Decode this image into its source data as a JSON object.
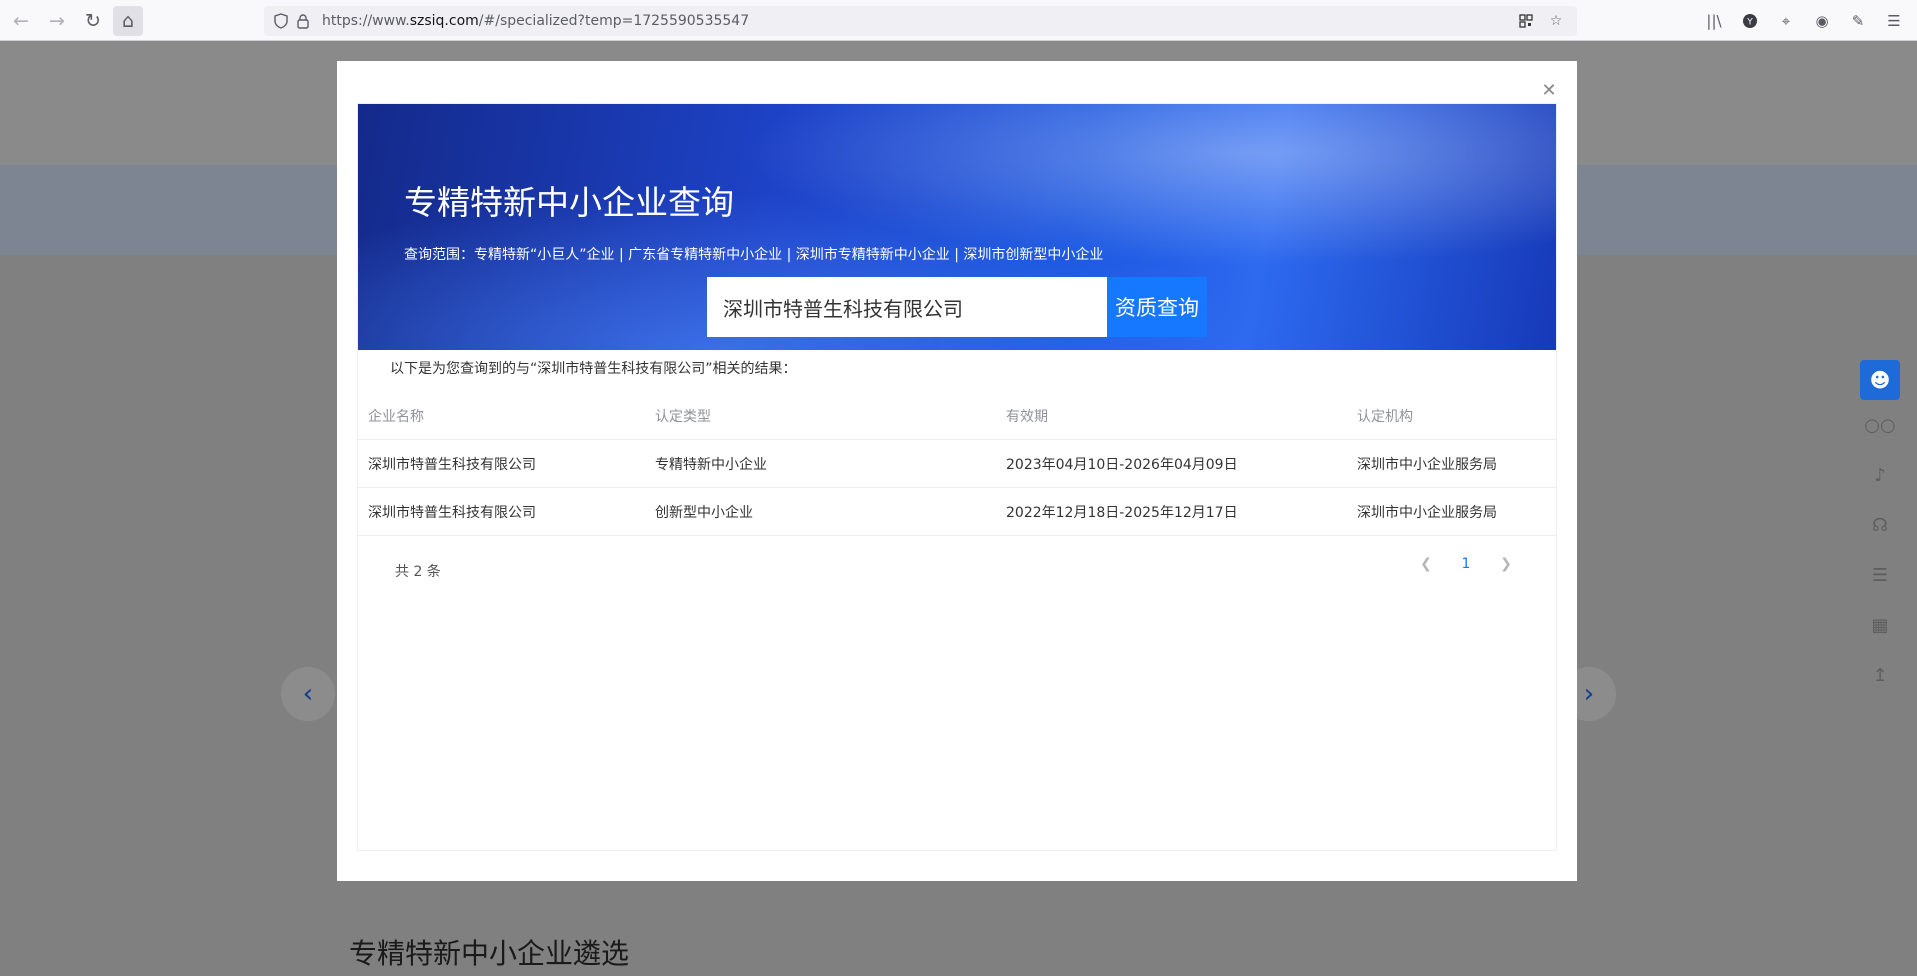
{
  "browser": {
    "url_prefix": "https://www.",
    "url_host": "szsiq.com",
    "url_path": "/#/specialized?temp=1725590535547"
  },
  "modal": {
    "title": "专精特新中小企业查询",
    "scope": "查询范围：专精特新“小巨人”企业 | 广东省专精特新中小企业 | 深圳市专精特新中小企业 | 深圳市创新型中小企业",
    "search": {
      "value": "深圳市特普生科技有限公司",
      "button": "资质查询"
    },
    "result_caption": "以下是为您查询到的与“深圳市特普生科技有限公司”相关的结果：",
    "table": {
      "headers": [
        "企业名称",
        "认定类型",
        "有效期",
        "认定机构"
      ],
      "rows": [
        [
          "深圳市特普生科技有限公司",
          "专精特新中小企业",
          "2023年04月10日-2026年04月09日",
          "深圳市中小企业服务局"
        ],
        [
          "深圳市特普生科技有限公司",
          "创新型中小企业",
          "2022年12月18日-2025年12月17日",
          "深圳市中小企业服务局"
        ]
      ]
    },
    "total": "共 2 条",
    "current_page": "1"
  },
  "background": {
    "section_title": "专精特新中小企业遴选"
  },
  "icons": {
    "back": "back-arrow-icon",
    "forward": "forward-arrow-icon",
    "reload": "reload-icon",
    "home": "home-icon",
    "close": "close-icon"
  },
  "colors": {
    "accent": "#1677ff",
    "overlay": "#808080"
  }
}
